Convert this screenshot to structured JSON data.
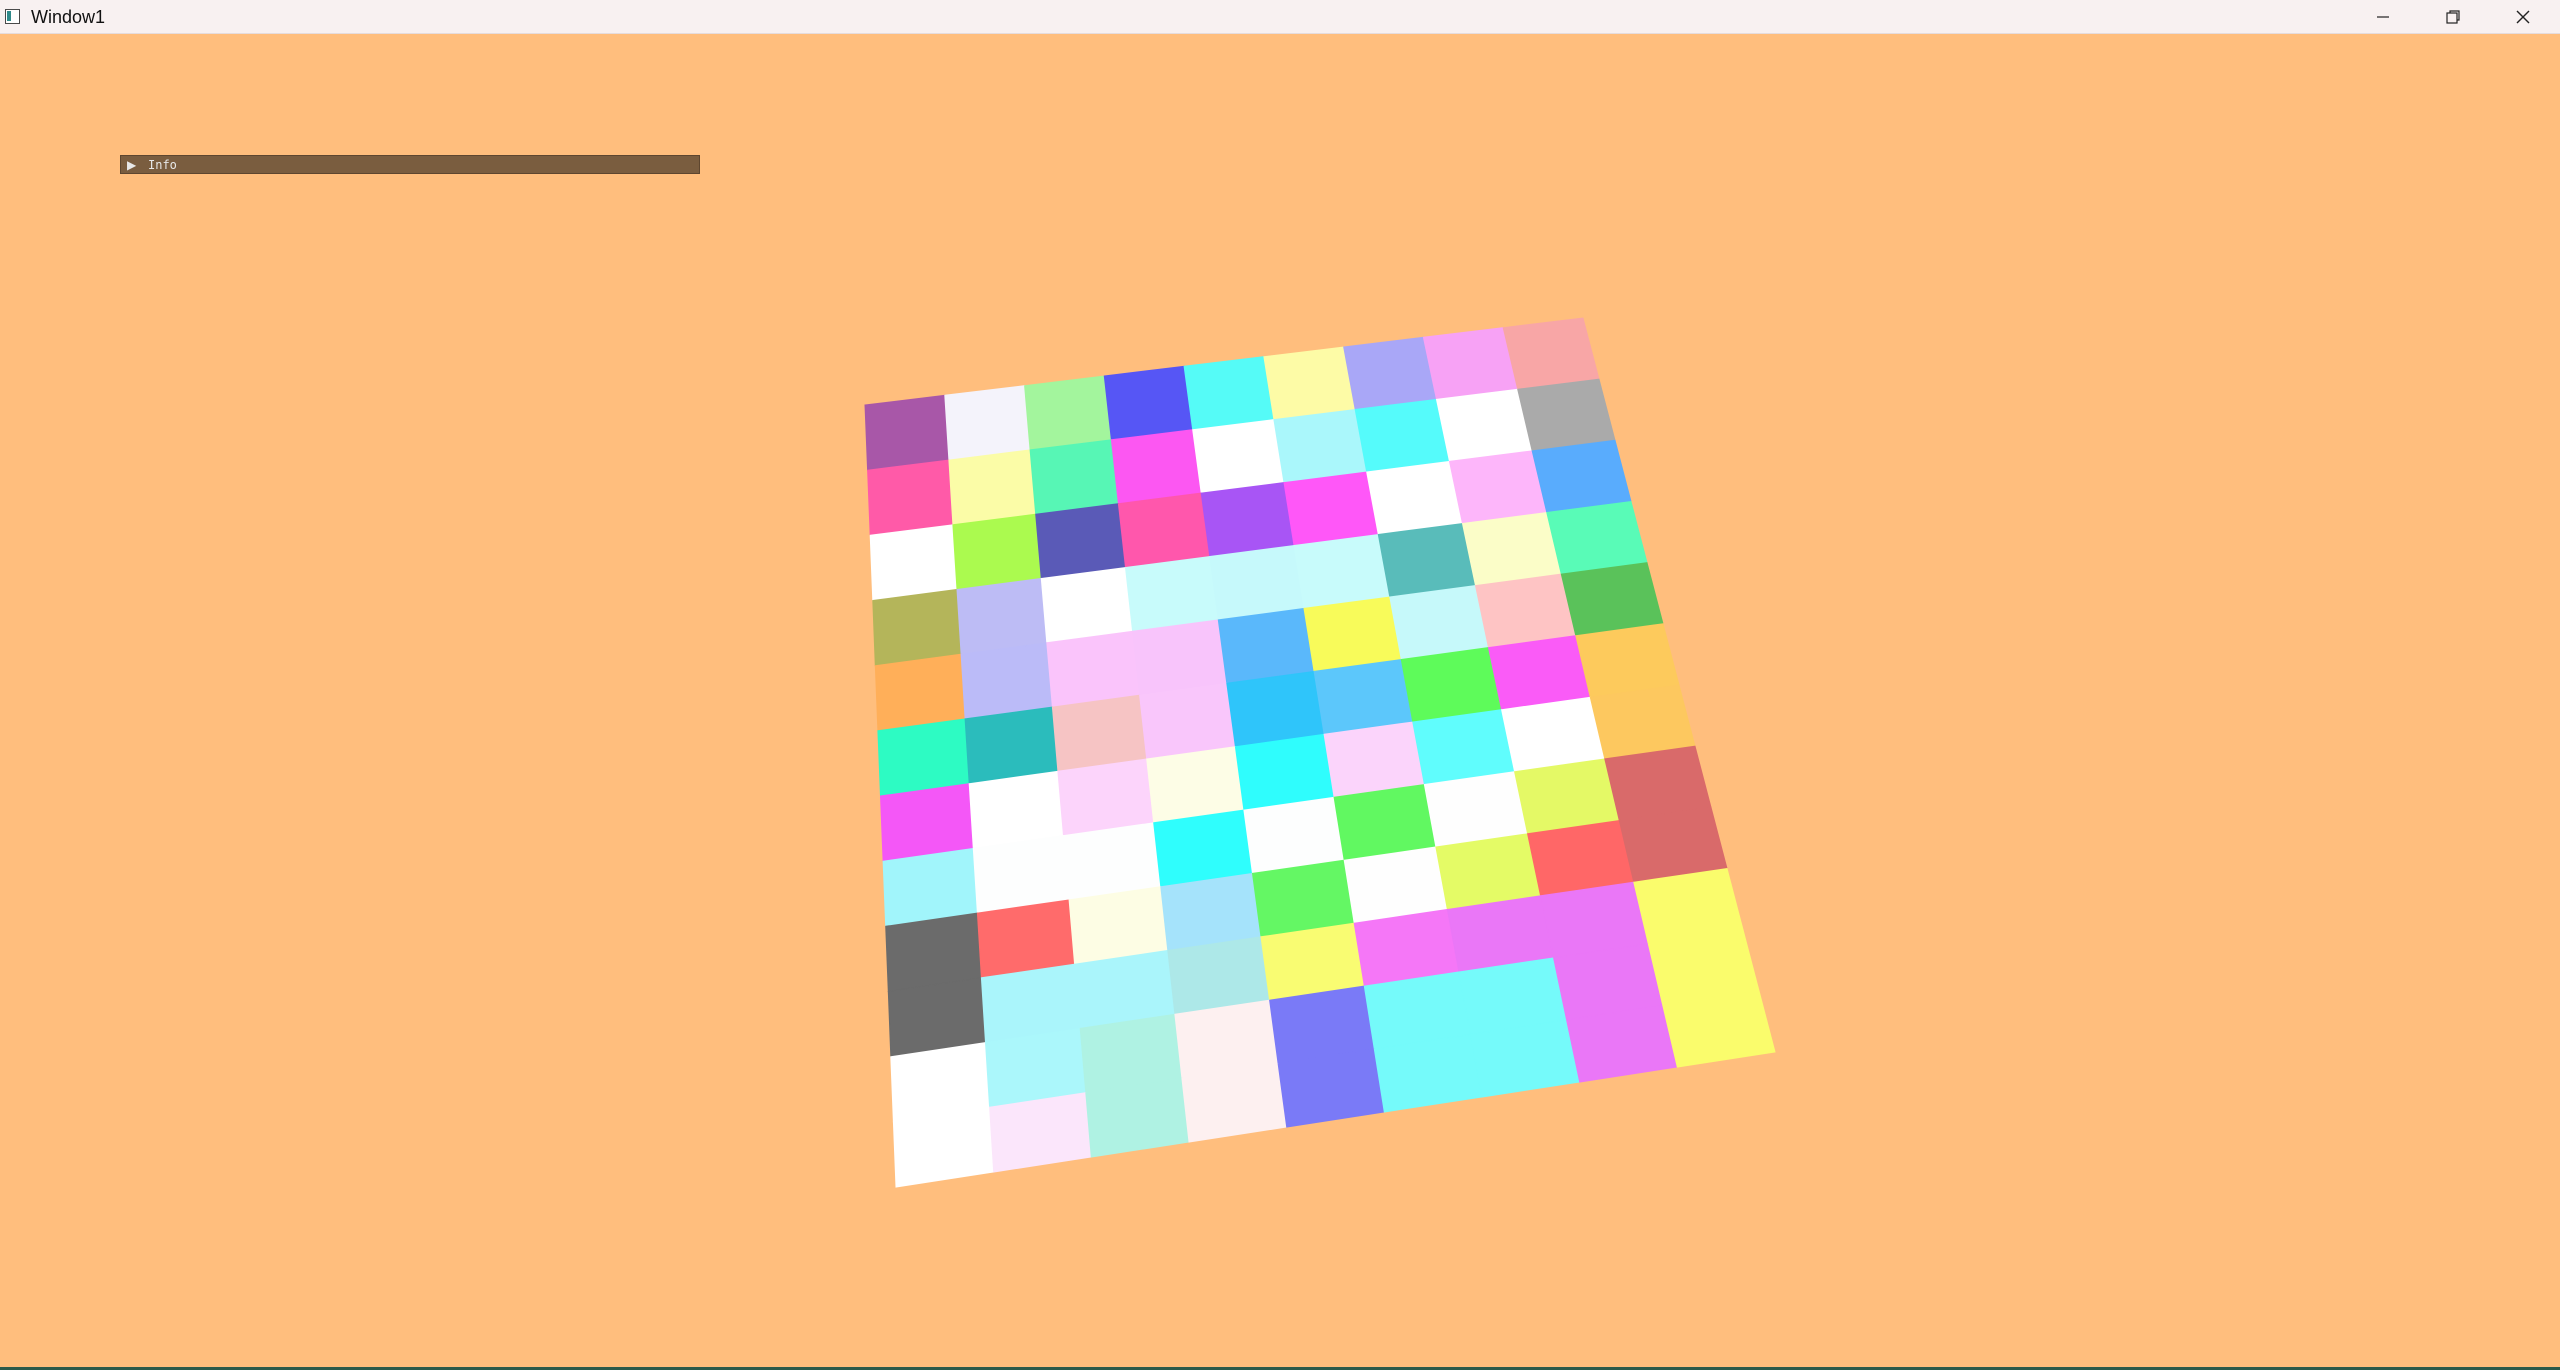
{
  "window": {
    "title": "Window1",
    "minimize_icon": "minimize-icon",
    "maximize_icon": "restore-icon",
    "close_icon": "close-icon"
  },
  "info_panel": {
    "label": "Info",
    "arrow_icon": "triangle-right-icon",
    "expanded": false
  },
  "colors": {
    "background": "#ffbe7d",
    "titlebar": "#f8f1f1",
    "panel": "#7a5d3f"
  },
  "patchwork": {
    "rows": 12,
    "cols": 9,
    "tile_colors": [
      "#a857a8",
      "#f4f3fb",
      "#a3f59d",
      "#5656f5",
      "#55fbf7",
      "#fdfba6",
      "#a9a7f7",
      "#f7a2f5",
      "#f8a6a6",
      "#ff5aa8",
      "#fbfca7",
      "#57f6b5",
      "#fc57f2",
      "#ffffff",
      "#aaf7fb",
      "#55fbfb",
      "#ffffff",
      "#aaaaaa",
      "#ffffff",
      "#abfa4f",
      "#5a5ab7",
      "#ff57ac",
      "#a855f5",
      "#ff57f8",
      "#ffffff",
      "#fdb6fa",
      "#59acfd",
      "#b4b55a",
      "#bdbcf5",
      "#ffffff",
      "#c8fbfb",
      "#c6f9fb",
      "#c8fbfb",
      "#59bcba",
      "#fbfdc8",
      "#59fbb7",
      "#ffaf59",
      "#bbbbf8",
      "#fac4fb",
      "#f8c4fb",
      "#5ab8fb",
      "#f8fb5a",
      "#c6f9fa",
      "#fec4c4",
      "#5ac25a",
      "#2dfbc3",
      "#2bbcbc",
      "#f6c4c4",
      "#f9c6fb",
      "#2fc5fa",
      "#5cc7fb",
      "#5efb5a",
      "#fa5bf7",
      "#fdca5c",
      "#f457f7",
      "#ffffff",
      "#fcd4fb",
      "#fdfde6",
      "#2ffdfd",
      "#fbd4fb",
      "#60fdfd",
      "#ffffff",
      "#fdc85f",
      "#a1f5fb",
      "#fdfefe",
      "#fdfefe",
      "#2ffefd",
      "#fdfefe",
      "#61f861",
      "#fefefe",
      "#e4f966",
      "#d96a6a",
      "#6b6b6b",
      "#ff6b6b",
      "#fdfde4",
      "#a5e3fb",
      "#64f764",
      "#fefefe",
      "#e4fb66",
      "#ff6767",
      "#d96a6a",
      "#6b6b6b",
      "#aaf5fb",
      "#aaf5fb",
      "#ade8e8",
      "#f9fc72",
      "#f577f7",
      "#ea77f7",
      "#ea77f7",
      "#fafc6c",
      "#ffffff",
      "#abf7fb",
      "#aff2e3",
      "#fdf0f0",
      "#7a7af7",
      "#75fafa",
      "#75fafa",
      "#ea77f7",
      "#fafc6c",
      "#ffffff",
      "#fbe6fb",
      "#aff2e3",
      "#fdf0f0",
      "#7a7af7",
      "#75fafa",
      "#75fafa",
      "#ea77f7",
      "#fafc6c"
    ]
  }
}
